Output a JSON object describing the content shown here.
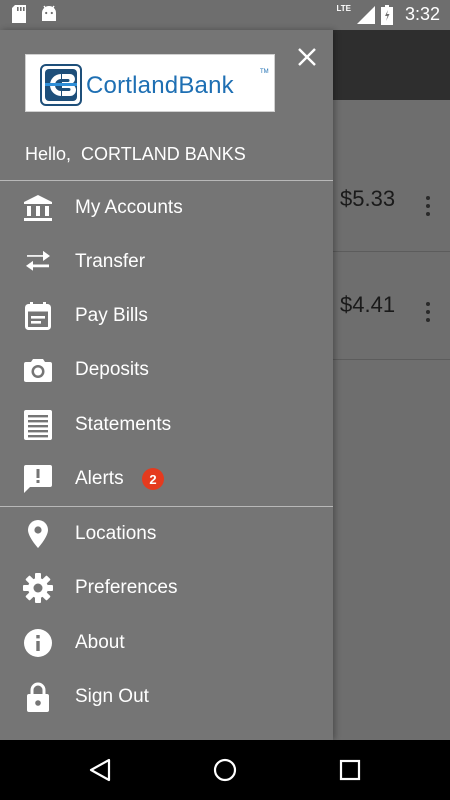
{
  "status_bar": {
    "time": "3:32",
    "network": "LTE"
  },
  "logo": {
    "brand": "CortlandBank",
    "trademark": "TM",
    "brand_color": "#1e6fb3"
  },
  "drawer": {
    "greeting": "Hello,  CORTLAND BANKS",
    "menu": [
      {
        "label": "My Accounts",
        "icon": "bank-icon"
      },
      {
        "label": "Transfer",
        "icon": "transfer-arrows-icon"
      },
      {
        "label": "Pay Bills",
        "icon": "calendar-bill-icon"
      },
      {
        "label": "Deposits",
        "icon": "camera-icon"
      },
      {
        "label": "Statements",
        "icon": "document-lines-icon"
      },
      {
        "label": "Alerts",
        "icon": "alert-message-icon",
        "badge": "2"
      },
      {
        "label": "Locations",
        "icon": "location-pin-icon"
      },
      {
        "label": "Preferences",
        "icon": "gear-icon"
      },
      {
        "label": "About",
        "icon": "info-icon"
      },
      {
        "label": "Sign Out",
        "icon": "lock-icon"
      }
    ]
  },
  "background": {
    "balances": [
      "$5.33",
      "$4.41"
    ]
  },
  "colors": {
    "badge": "#e53a1e",
    "drawer": "#757575",
    "toolbar": "#2e2e2e"
  }
}
